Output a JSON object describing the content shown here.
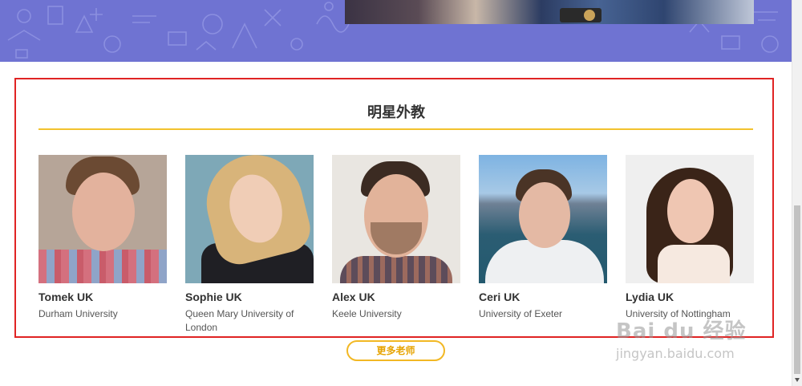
{
  "section": {
    "title": "明星外教",
    "more_button": "更多老师"
  },
  "teachers": [
    {
      "name": "Tomek UK",
      "school": "Durham University"
    },
    {
      "name": "Sophie UK",
      "school": "Queen Mary University of London"
    },
    {
      "name": "Alex UK",
      "school": "Keele University"
    },
    {
      "name": "Ceri UK",
      "school": "University of Exeter"
    },
    {
      "name": "Lydia UK",
      "school": "University of Nottingham"
    }
  ],
  "watermark": {
    "logo": "Bai du 经验",
    "url": "jingyan.baidu.com"
  },
  "colors": {
    "banner": "#6f73d2",
    "accent_line": "#f2c22e",
    "button_border": "#f2b824",
    "highlight_box": "#e02424"
  }
}
